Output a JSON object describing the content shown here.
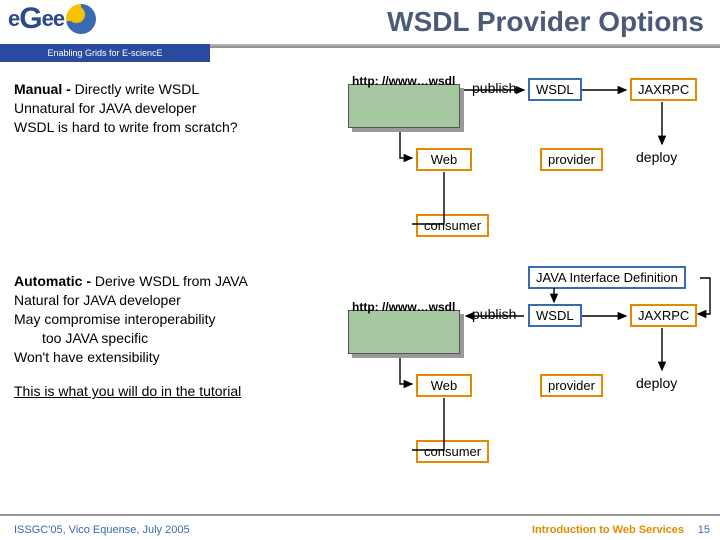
{
  "title": "WSDL Provider  Options",
  "logo": {
    "text": "eGee",
    "tagline": "Enabling Grids for E-sciencE"
  },
  "section1": {
    "heading": "Manual - ",
    "line1": "Directly write WSDL",
    "line2": "Unnatural for JAVA developer",
    "line3": "WSDL is hard to write from scratch?"
  },
  "section2": {
    "heading": "Automatic - ",
    "line1": "Derive WSDL from JAVA",
    "line2": "Natural for JAVA developer",
    "line3": "May compromise interoperability",
    "line3a": "too JAVA specific",
    "line4": "Won't have extensibility",
    "note": "This is what you will do in the tutorial"
  },
  "diagram": {
    "doc_label": "http: //www…wsdl",
    "publish": "publish",
    "wsdl": "WSDL",
    "jaxrpc": "JAXRPC",
    "web": "Web",
    "provider": "provider",
    "deploy": "deploy",
    "consumer": "consumer",
    "java_iface": "JAVA Interface Definition"
  },
  "footer": {
    "left": "ISSGC'05, Vico Equense, July 2005",
    "right": "Introduction to Web Services",
    "page": "15"
  },
  "colors": {
    "blue": "#3a6ab0",
    "orange": "#e38b00",
    "green": "#a6c8a0"
  }
}
